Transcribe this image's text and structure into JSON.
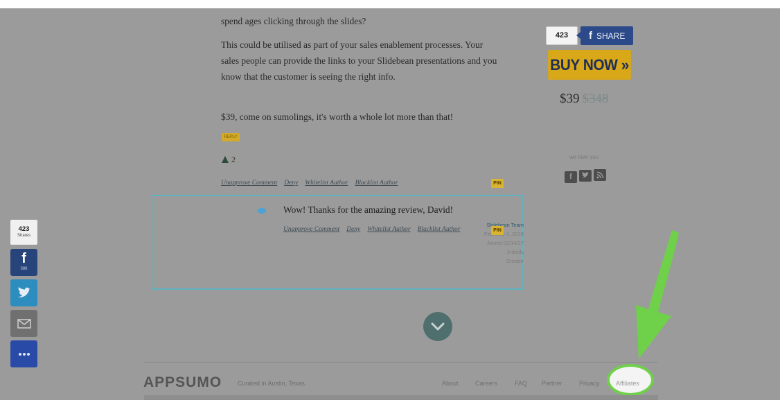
{
  "article": {
    "paragraphs": [
      "spend ages clicking through the slides?",
      "This could be utilised as part of your sales enablement processes. Your sales people can provide the links to your Slidebean presentations and you know that the customer is seeing the right info.",
      "$39, come on sumolings, it's worth a whole lot more than that!"
    ],
    "reply_label": "REPLY",
    "vote_count": "2",
    "admin_links": [
      "Unapprove Comment",
      "Deny",
      "Whitelist Author",
      "Blacklist Author"
    ],
    "pin_label": "PIN"
  },
  "reply": {
    "author_name": "Slidebean Team",
    "date": "February 1, 2018",
    "joined": "Joined 02/14/17",
    "deals": "3 deals",
    "role": "Creator",
    "text": "Wow! Thanks for the amazing review, David!",
    "admin_links": [
      "Unapprove Comment",
      "Deny",
      "Whitelist Author",
      "Blacklist Author"
    ],
    "pin_label": "PIN"
  },
  "sidebar_right": {
    "share_count": "423",
    "share_label": "SHARE",
    "buy_label": "BUY NOW »",
    "price": "$39",
    "old_price": "$348",
    "love_text": "we love you"
  },
  "left_share": {
    "count": "423",
    "count_label": "Shares",
    "facebook_count": "386"
  },
  "footer": {
    "logo": "APPSUMO",
    "tagline": "Curated in Austin, Texas.",
    "nav": [
      "About",
      "Careers",
      "FAQ",
      "Partner",
      "Privacy"
    ],
    "affiliates": "Affiliates"
  },
  "colors": {
    "highlight_ring": "#6fd04a",
    "arrow": "#6fd04a",
    "buy_button": "#d8a818",
    "facebook": "#2c4a8a",
    "twitter": "#2e8dbf"
  }
}
